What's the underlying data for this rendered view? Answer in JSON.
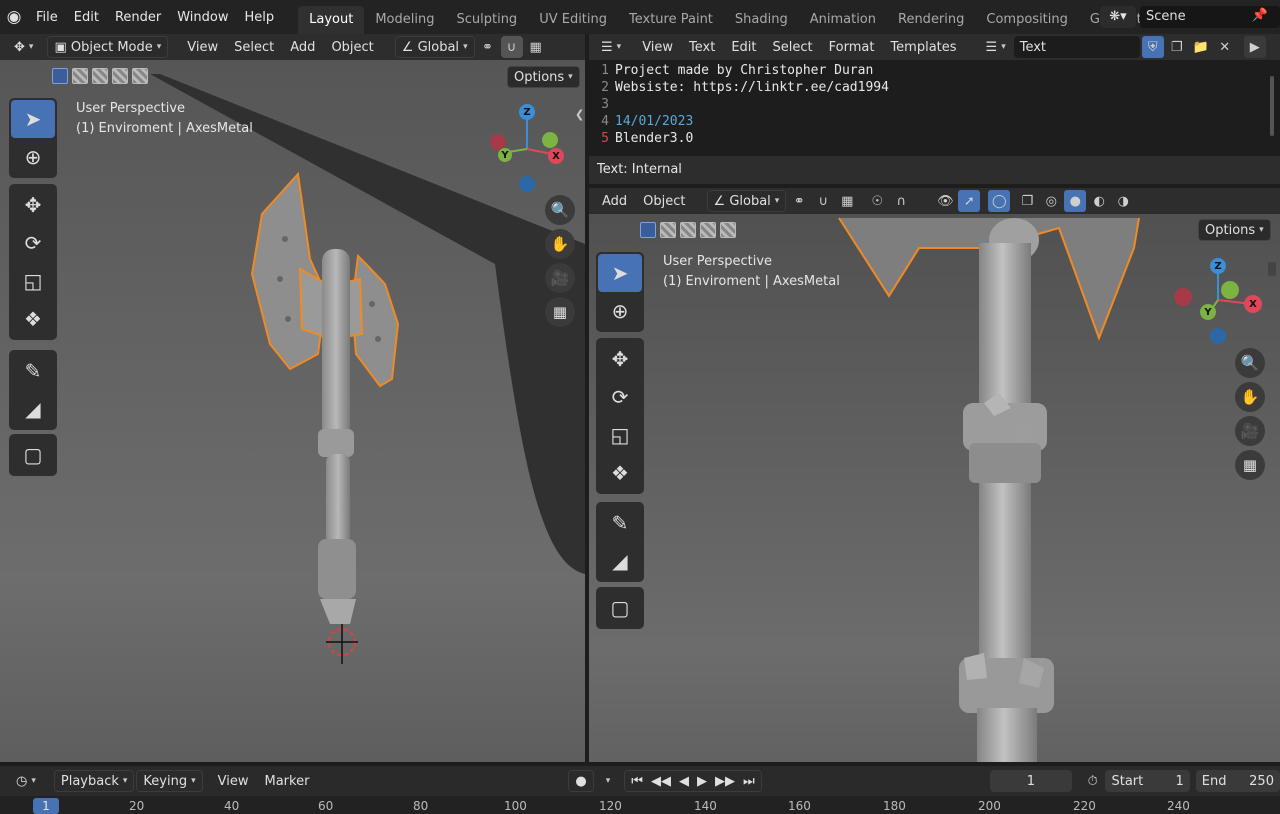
{
  "topbar": {
    "menu": [
      "File",
      "Edit",
      "Render",
      "Window",
      "Help"
    ],
    "workspaces": [
      "Layout",
      "Modeling",
      "Sculpting",
      "UV Editing",
      "Texture Paint",
      "Shading",
      "Animation",
      "Rendering",
      "Compositing",
      "Geometry Noc"
    ],
    "active_workspace": "Layout",
    "scene_name": "Scene"
  },
  "left_viewport": {
    "mode": "Object Mode",
    "menu": [
      "View",
      "Select",
      "Add",
      "Object"
    ],
    "orientation": "Global",
    "options_label": "Options",
    "overlay_line1": "User Perspective",
    "overlay_line2": "(1) Enviroment | AxesMetal"
  },
  "text_editor": {
    "menu": [
      "View",
      "Text",
      "Edit",
      "Select",
      "Format",
      "Templates"
    ],
    "text_name": "Text",
    "lines": [
      {
        "n": "1",
        "text": "Project made by Christopher Duran"
      },
      {
        "n": "2",
        "text": "Websiste: https://linktr.ee/cad1994"
      },
      {
        "n": "3",
        "text": ""
      },
      {
        "n": "4",
        "text": "14/01/2023"
      },
      {
        "n": "5",
        "text": "Blender3.0"
      }
    ],
    "status": "Text: Internal"
  },
  "right_viewport": {
    "menu": [
      "Add",
      "Object"
    ],
    "orientation": "Global",
    "options_label": "Options",
    "overlay_line1": "User Perspective",
    "overlay_line2": "(1) Enviroment | AxesMetal"
  },
  "gizmo": {
    "x": "X",
    "y": "Y",
    "z": "Z"
  },
  "timeline": {
    "menu": [
      "Playback",
      "Keying",
      "View",
      "Marker"
    ],
    "current_frame": "1",
    "start_label": "Start",
    "start": "1",
    "end_label": "End",
    "end": "250",
    "ruler": [
      "1",
      "20",
      "40",
      "60",
      "80",
      "100",
      "120",
      "140",
      "160",
      "180",
      "200",
      "220",
      "240"
    ]
  },
  "colors": {
    "accent": "#4772b3",
    "selection_outline": "#f08a24",
    "gizmo_x": "#e0485a",
    "gizmo_y": "#7cb342",
    "gizmo_z": "#3a8fd8"
  }
}
